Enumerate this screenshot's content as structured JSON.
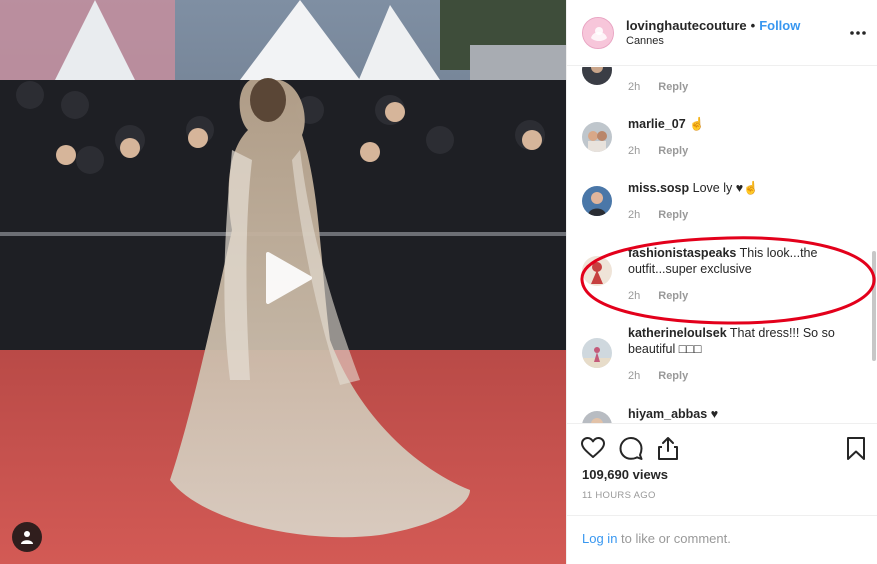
{
  "post": {
    "username": "lovinghautecouture",
    "separator": "•",
    "follow_label": "Follow",
    "location": "Cannes"
  },
  "comments": [
    {
      "username": "",
      "text": "",
      "time": "2h",
      "reply_label": "Reply"
    },
    {
      "username": "marlie_07",
      "text": "☝",
      "time": "2h",
      "reply_label": "Reply"
    },
    {
      "username": "miss.sosp",
      "text": "Love ly ♥☝",
      "time": "2h",
      "reply_label": "Reply"
    },
    {
      "username": "fashionistaspeaks",
      "text": "This look...the outfit...super exclusive",
      "time": "2h",
      "reply_label": "Reply"
    },
    {
      "username": "katherineloulsek",
      "text": "That dress!!! So so beautiful □□□",
      "time": "2h",
      "reply_label": "Reply"
    },
    {
      "username": "hiyam_abbas",
      "text": "♥",
      "time": "",
      "reply_label": ""
    }
  ],
  "stats": {
    "views": "109,690 views",
    "time_ago": "11 HOURS AGO"
  },
  "login": {
    "link": "Log in",
    "rest": " to like or comment."
  },
  "colors": {
    "accent": "#3897f0",
    "highlight_ring": "#e3001b",
    "carpet": "#c8504c",
    "muted_text": "#999999"
  },
  "icons": [
    "play-icon",
    "user-tag-icon",
    "more-options-icon",
    "heart-icon",
    "comment-icon",
    "share-icon",
    "bookmark-icon"
  ]
}
